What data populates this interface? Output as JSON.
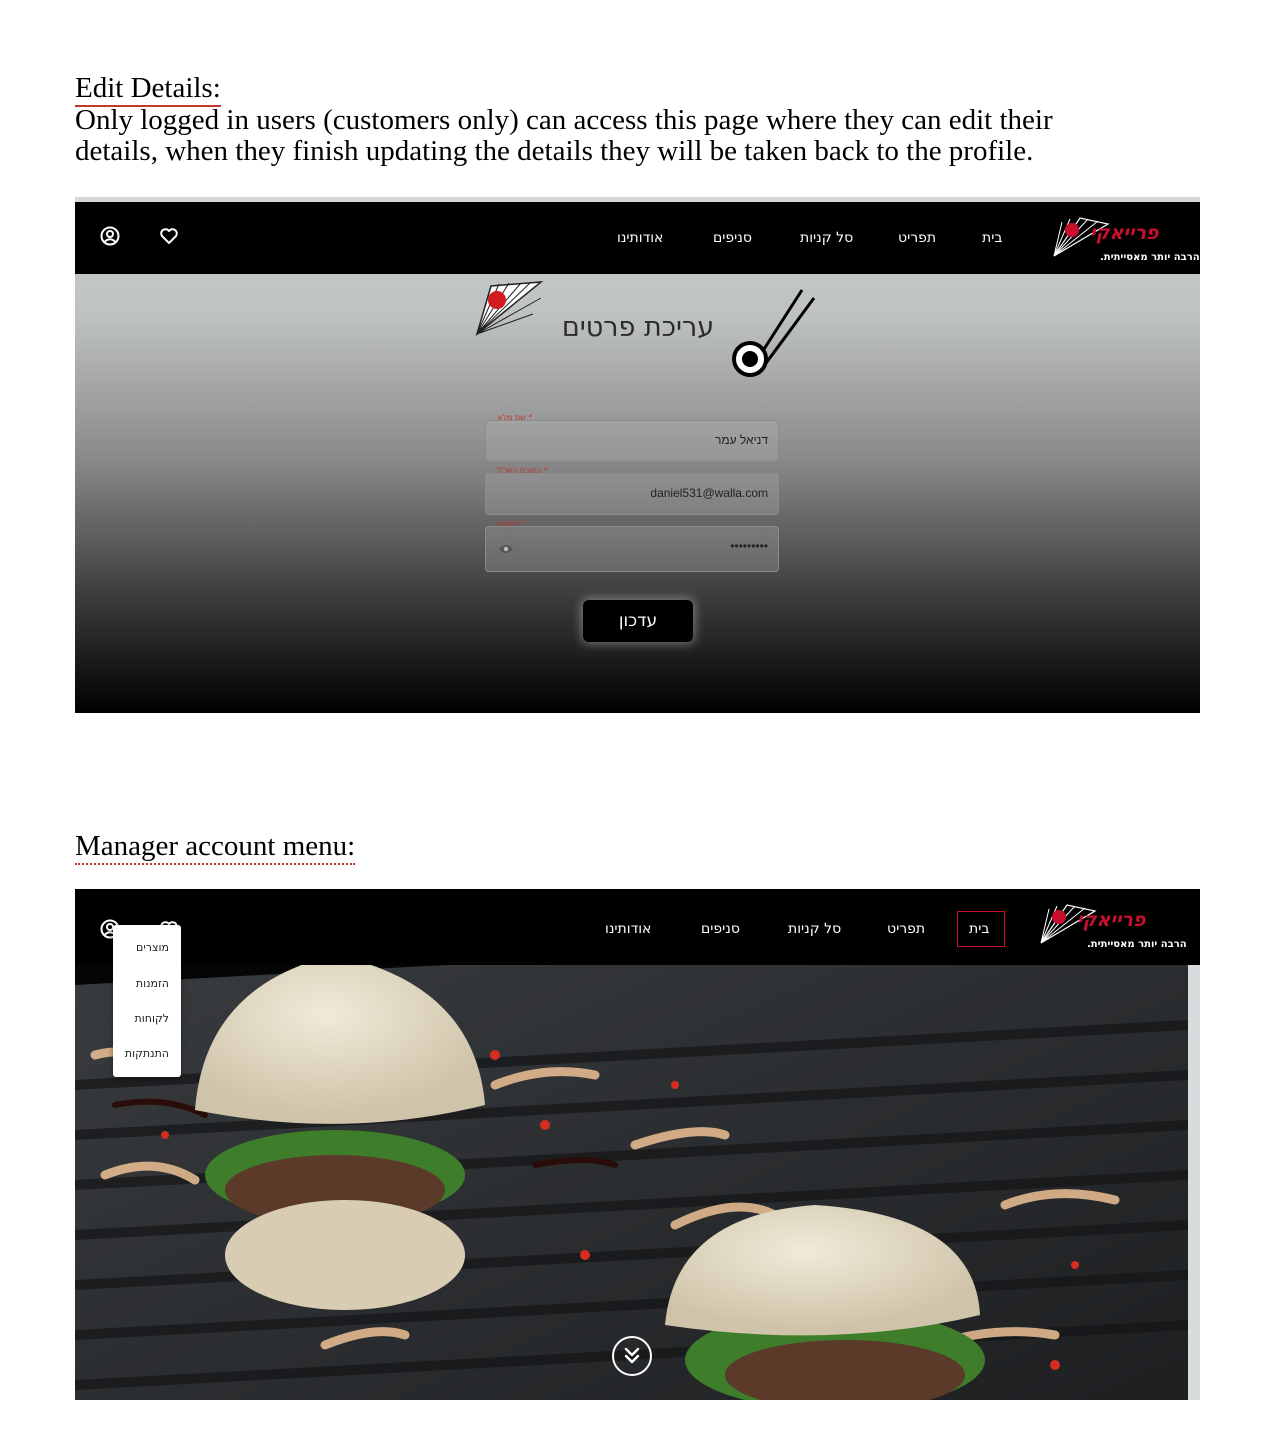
{
  "section1": {
    "heading": "Edit Details:",
    "paragraph_line1": "Only logged in users (customers only) can access this page where they can edit their",
    "paragraph_line2": "details, when they finish updating the details they will be taken back to the profile."
  },
  "shot1": {
    "nav": {
      "links": [
        "בית",
        "תפריט",
        "סל קניות",
        "סניפים",
        "אודותינו"
      ],
      "logo_title": "פרייאקי",
      "logo_tagline": "הרבה יותר מאסייתית."
    },
    "page_title": "עריכת פרטים",
    "fields": {
      "name_label": "* שם מלא",
      "name_value": "דניאל עמר",
      "email_label": "* כתובת דוא\"ל",
      "email_value": "daniel531@walla.com",
      "password_label": "* סיסמא",
      "password_value": "•••••••••"
    },
    "update_button": "עדכון"
  },
  "section2": {
    "heading": "Manager account menu:"
  },
  "shot2": {
    "nav": {
      "links": [
        "בית",
        "תפריט",
        "סל קניות",
        "סניפים",
        "אודותינו"
      ],
      "logo_title": "פרייאקי",
      "logo_tagline": "הרבה יותר מאסייתית."
    },
    "menu_items": [
      "מוצרים",
      "הזמנות",
      "לקוחות",
      "התנתקות"
    ]
  },
  "colors": {
    "brand_red": "#c8102e",
    "nav_bg": "#000000"
  }
}
